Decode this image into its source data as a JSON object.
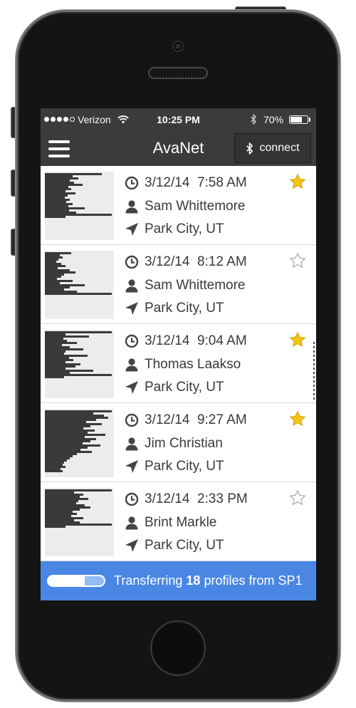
{
  "status_bar": {
    "signal": {
      "filled": 4,
      "total": 5
    },
    "carrier": "Verizon",
    "time": "10:25 PM",
    "battery_percent": "70%",
    "battery_level": 0.7,
    "icons": [
      "signal-dots",
      "wifi-icon",
      "bluetooth-icon",
      "battery-icon"
    ]
  },
  "nav_bar": {
    "menu_icon": "hamburger-icon",
    "title": "AvaNet",
    "connect_button": {
      "label": "connect",
      "icon": "bluetooth-icon"
    }
  },
  "list": {
    "row_icons": {
      "date": "clock-icon",
      "observer": "person-icon",
      "location": "location-arrow-icon",
      "favorite": "star-icon"
    },
    "items": [
      {
        "datetime": "3/12/14  7:58 AM",
        "observer": "Sam Whittemore",
        "location": "Park City, UT",
        "starred": true,
        "profile_layers": [
          0.82,
          0.4,
          0.48,
          0.36,
          0.42,
          0.55,
          0.34,
          0.38,
          0.3,
          0.44,
          0.33,
          0.29,
          0.36,
          0.31,
          0.4,
          0.34,
          0.58,
          0.35,
          0.45,
          0.97,
          0.3
        ]
      },
      {
        "datetime": "3/12/14  8:12 AM",
        "observer": "Sam Whittemore",
        "location": "Park City, UT",
        "starred": false,
        "profile_layers": [
          0.38,
          0.22,
          0.26,
          0.2,
          0.17,
          0.24,
          0.3,
          0.19,
          0.36,
          0.44,
          0.28,
          0.24,
          0.18,
          0.4,
          0.22,
          0.58,
          0.36,
          0.28,
          0.46,
          0.97
        ]
      },
      {
        "datetime": "3/12/14  9:04 AM",
        "observer": "Thomas Laakso",
        "location": "Park City, UT",
        "starred": true,
        "profile_layers": [
          0.97,
          0.3,
          0.64,
          0.27,
          0.32,
          0.46,
          0.25,
          0.36,
          0.56,
          0.3,
          0.28,
          0.62,
          0.35,
          0.41,
          0.3,
          0.52,
          0.44,
          0.3,
          0.7,
          0.36,
          0.97,
          0.28
        ]
      },
      {
        "datetime": "3/12/14  9:27 AM",
        "observer": "Jim Christian",
        "location": "Park City, UT",
        "starred": true,
        "profile_layers": [
          0.97,
          0.7,
          0.86,
          0.92,
          0.74,
          0.6,
          0.82,
          0.66,
          0.56,
          0.72,
          0.62,
          0.88,
          0.58,
          0.74,
          0.66,
          0.55,
          0.8,
          0.62,
          0.52,
          0.68,
          0.46,
          0.4,
          0.36,
          0.32,
          0.28,
          0.26,
          0.3,
          0.23,
          0.26
        ]
      },
      {
        "datetime": "3/12/14  2:33 PM",
        "observer": "Brint Markle",
        "location": "Park City, UT",
        "starred": false,
        "profile_layers": [
          0.97,
          0.42,
          0.56,
          0.5,
          0.63,
          0.48,
          0.45,
          0.58,
          0.66,
          0.5,
          0.4,
          0.46,
          0.38,
          0.56,
          0.42,
          0.5,
          0.97,
          0.3
        ]
      }
    ]
  },
  "footer": {
    "progress": 0.65,
    "text_prefix": "Transferring",
    "count": "18",
    "text_suffix": "profiles from SP1"
  },
  "colors": {
    "header": "#3b3b3b",
    "accent": "#4a87e4",
    "star": "#f5c314",
    "text": "#3a3a3a",
    "profile_layer": "#3a3a3a"
  }
}
